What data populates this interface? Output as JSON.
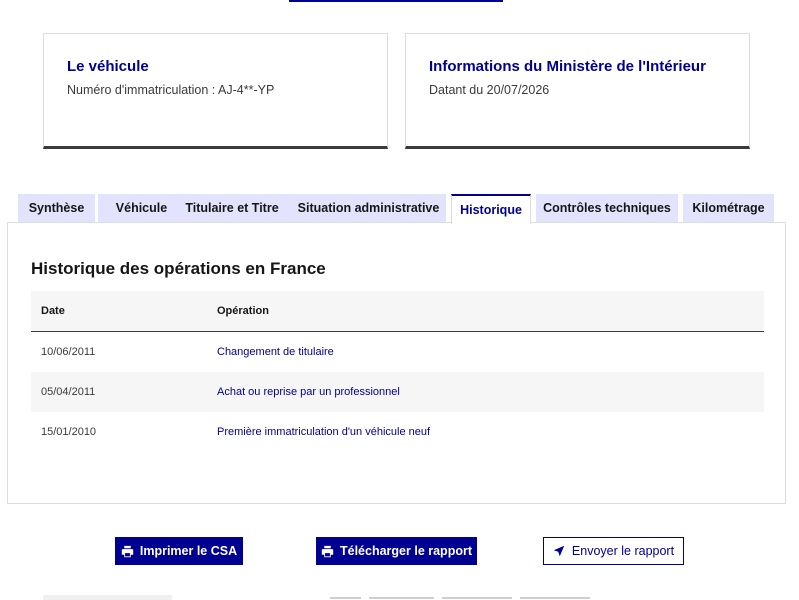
{
  "vehicle_card": {
    "title": "Le véhicule",
    "registration": "Numéro d'immatriculation : AJ-4**-YP"
  },
  "ministry_card": {
    "title": "Informations du Ministère de l'Intérieur",
    "date": "Datant du 20/07/2026"
  },
  "tabs": [
    {
      "label": "Synthèse",
      "active": false
    },
    {
      "label": "Véhicule",
      "active": false
    },
    {
      "label": "Titulaire et Titre",
      "active": false
    },
    {
      "label": "Situation administrative",
      "active": false
    },
    {
      "label": "Historique",
      "active": true
    },
    {
      "label": "Contrôles techniques",
      "active": false
    },
    {
      "label": "Kilométrage",
      "active": false
    }
  ],
  "history": {
    "title": "Historique des opérations en France",
    "columns": {
      "date": "Date",
      "operation": "Opération"
    },
    "rows": [
      {
        "date": "10/06/2011",
        "operation": "Changement de titulaire"
      },
      {
        "date": "05/04/2011",
        "operation": "Achat ou reprise par un professionnel"
      },
      {
        "date": "15/01/2010",
        "operation": "Première immatriculation d'un véhicule neuf"
      }
    ]
  },
  "actions": {
    "print_label": "Imprimer le CSA",
    "download_label": "Télécharger le rapport",
    "send_label": "Envoyer le rapport"
  },
  "icons": {
    "print": "printer-icon",
    "download": "printer-icon",
    "send": "send-arrow-icon"
  },
  "colors": {
    "primary": "#000091",
    "tab_bg": "#e3e3fd",
    "text": "#161616",
    "row_alt": "#f6f6f6"
  }
}
